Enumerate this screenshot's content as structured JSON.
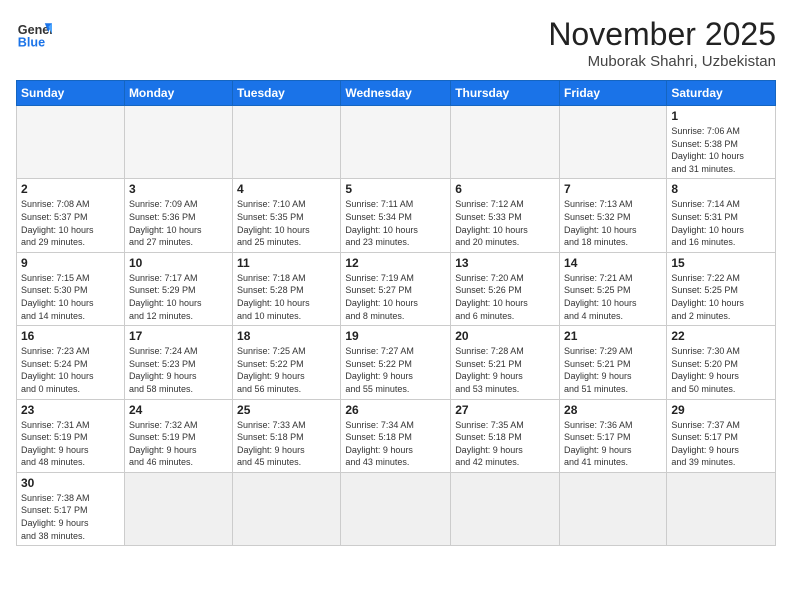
{
  "header": {
    "logo_general": "General",
    "logo_blue": "Blue",
    "month_title": "November 2025",
    "location": "Muborak Shahri, Uzbekistan"
  },
  "weekdays": [
    "Sunday",
    "Monday",
    "Tuesday",
    "Wednesday",
    "Thursday",
    "Friday",
    "Saturday"
  ],
  "days": [
    {
      "date": "",
      "info": ""
    },
    {
      "date": "",
      "info": ""
    },
    {
      "date": "",
      "info": ""
    },
    {
      "date": "",
      "info": ""
    },
    {
      "date": "",
      "info": ""
    },
    {
      "date": "",
      "info": ""
    },
    {
      "date": "1",
      "info": "Sunrise: 7:06 AM\nSunset: 5:38 PM\nDaylight: 10 hours\nand 31 minutes."
    },
    {
      "date": "2",
      "info": "Sunrise: 7:08 AM\nSunset: 5:37 PM\nDaylight: 10 hours\nand 29 minutes."
    },
    {
      "date": "3",
      "info": "Sunrise: 7:09 AM\nSunset: 5:36 PM\nDaylight: 10 hours\nand 27 minutes."
    },
    {
      "date": "4",
      "info": "Sunrise: 7:10 AM\nSunset: 5:35 PM\nDaylight: 10 hours\nand 25 minutes."
    },
    {
      "date": "5",
      "info": "Sunrise: 7:11 AM\nSunset: 5:34 PM\nDaylight: 10 hours\nand 23 minutes."
    },
    {
      "date": "6",
      "info": "Sunrise: 7:12 AM\nSunset: 5:33 PM\nDaylight: 10 hours\nand 20 minutes."
    },
    {
      "date": "7",
      "info": "Sunrise: 7:13 AM\nSunset: 5:32 PM\nDaylight: 10 hours\nand 18 minutes."
    },
    {
      "date": "8",
      "info": "Sunrise: 7:14 AM\nSunset: 5:31 PM\nDaylight: 10 hours\nand 16 minutes."
    },
    {
      "date": "9",
      "info": "Sunrise: 7:15 AM\nSunset: 5:30 PM\nDaylight: 10 hours\nand 14 minutes."
    },
    {
      "date": "10",
      "info": "Sunrise: 7:17 AM\nSunset: 5:29 PM\nDaylight: 10 hours\nand 12 minutes."
    },
    {
      "date": "11",
      "info": "Sunrise: 7:18 AM\nSunset: 5:28 PM\nDaylight: 10 hours\nand 10 minutes."
    },
    {
      "date": "12",
      "info": "Sunrise: 7:19 AM\nSunset: 5:27 PM\nDaylight: 10 hours\nand 8 minutes."
    },
    {
      "date": "13",
      "info": "Sunrise: 7:20 AM\nSunset: 5:26 PM\nDaylight: 10 hours\nand 6 minutes."
    },
    {
      "date": "14",
      "info": "Sunrise: 7:21 AM\nSunset: 5:25 PM\nDaylight: 10 hours\nand 4 minutes."
    },
    {
      "date": "15",
      "info": "Sunrise: 7:22 AM\nSunset: 5:25 PM\nDaylight: 10 hours\nand 2 minutes."
    },
    {
      "date": "16",
      "info": "Sunrise: 7:23 AM\nSunset: 5:24 PM\nDaylight: 10 hours\nand 0 minutes."
    },
    {
      "date": "17",
      "info": "Sunrise: 7:24 AM\nSunset: 5:23 PM\nDaylight: 9 hours\nand 58 minutes."
    },
    {
      "date": "18",
      "info": "Sunrise: 7:25 AM\nSunset: 5:22 PM\nDaylight: 9 hours\nand 56 minutes."
    },
    {
      "date": "19",
      "info": "Sunrise: 7:27 AM\nSunset: 5:22 PM\nDaylight: 9 hours\nand 55 minutes."
    },
    {
      "date": "20",
      "info": "Sunrise: 7:28 AM\nSunset: 5:21 PM\nDaylight: 9 hours\nand 53 minutes."
    },
    {
      "date": "21",
      "info": "Sunrise: 7:29 AM\nSunset: 5:21 PM\nDaylight: 9 hours\nand 51 minutes."
    },
    {
      "date": "22",
      "info": "Sunrise: 7:30 AM\nSunset: 5:20 PM\nDaylight: 9 hours\nand 50 minutes."
    },
    {
      "date": "23",
      "info": "Sunrise: 7:31 AM\nSunset: 5:19 PM\nDaylight: 9 hours\nand 48 minutes."
    },
    {
      "date": "24",
      "info": "Sunrise: 7:32 AM\nSunset: 5:19 PM\nDaylight: 9 hours\nand 46 minutes."
    },
    {
      "date": "25",
      "info": "Sunrise: 7:33 AM\nSunset: 5:18 PM\nDaylight: 9 hours\nand 45 minutes."
    },
    {
      "date": "26",
      "info": "Sunrise: 7:34 AM\nSunset: 5:18 PM\nDaylight: 9 hours\nand 43 minutes."
    },
    {
      "date": "27",
      "info": "Sunrise: 7:35 AM\nSunset: 5:18 PM\nDaylight: 9 hours\nand 42 minutes."
    },
    {
      "date": "28",
      "info": "Sunrise: 7:36 AM\nSunset: 5:17 PM\nDaylight: 9 hours\nand 41 minutes."
    },
    {
      "date": "29",
      "info": "Sunrise: 7:37 AM\nSunset: 5:17 PM\nDaylight: 9 hours\nand 39 minutes."
    },
    {
      "date": "30",
      "info": "Sunrise: 7:38 AM\nSunset: 5:17 PM\nDaylight: 9 hours\nand 38 minutes."
    },
    {
      "date": "",
      "info": ""
    },
    {
      "date": "",
      "info": ""
    },
    {
      "date": "",
      "info": ""
    },
    {
      "date": "",
      "info": ""
    },
    {
      "date": "",
      "info": ""
    },
    {
      "date": "",
      "info": ""
    }
  ]
}
